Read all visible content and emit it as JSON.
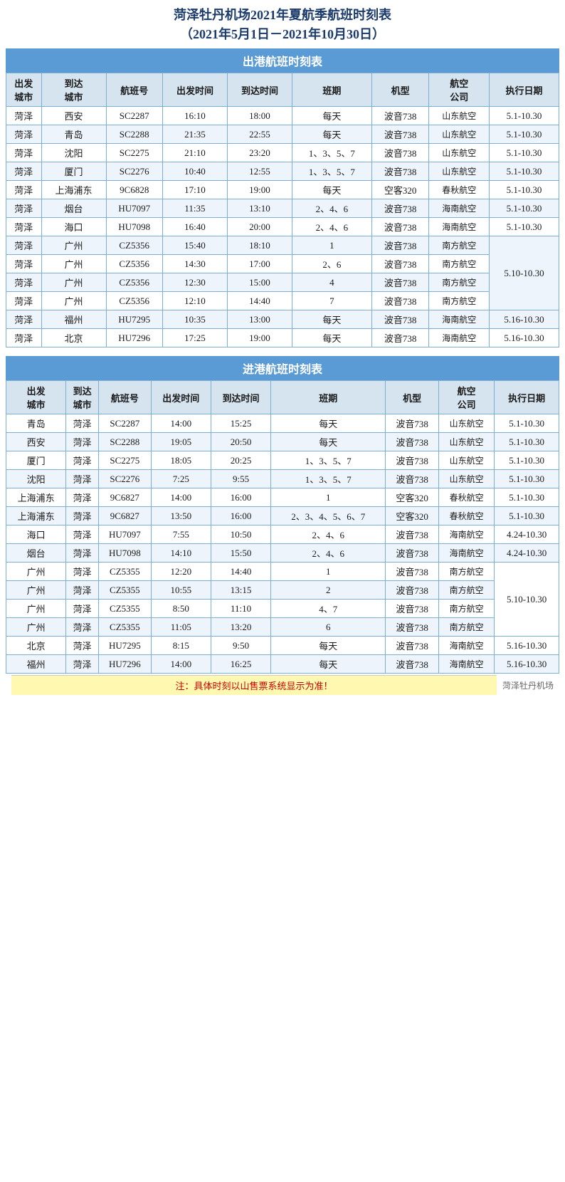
{
  "title": {
    "line1": "菏泽牡丹机场2021年夏航季航班时刻表",
    "line2": "（2021年5月1日－2021年10月30日）"
  },
  "departure_section": {
    "header": "出港航班时刻表",
    "columns": [
      "出发城市",
      "到达城市",
      "航班号",
      "出发时间",
      "到达时间",
      "班期",
      "机型",
      "航空公司",
      "执行日期"
    ],
    "rows": [
      [
        "菏泽",
        "西安",
        "SC2287",
        "16:10",
        "18:00",
        "每天",
        "波音738",
        "山东航空",
        "5.1-10.30"
      ],
      [
        "菏泽",
        "青岛",
        "SC2288",
        "21:35",
        "22:55",
        "每天",
        "波音738",
        "山东航空",
        "5.1-10.30"
      ],
      [
        "菏泽",
        "沈阳",
        "SC2275",
        "21:10",
        "23:20",
        "1、3、5、7",
        "波音738",
        "山东航空",
        "5.1-10.30"
      ],
      [
        "菏泽",
        "厦门",
        "SC2276",
        "10:40",
        "12:55",
        "1、3、5、7",
        "波音738",
        "山东航空",
        "5.1-10.30"
      ],
      [
        "菏泽",
        "上海浦东",
        "9C6828",
        "17:10",
        "19:00",
        "每天",
        "空客320",
        "春秋航空",
        "5.1-10.30"
      ],
      [
        "菏泽",
        "烟台",
        "HU7097",
        "11:35",
        "13:10",
        "2、4、6",
        "波音738",
        "海南航空",
        "5.1-10.30"
      ],
      [
        "菏泽",
        "海口",
        "HU7098",
        "16:40",
        "20:00",
        "2、4、6",
        "波音738",
        "海南航空",
        "5.1-10.30"
      ],
      [
        "菏泽",
        "广州",
        "CZ5356",
        "15:40",
        "18:10",
        "1",
        "波音738",
        "南方航空",
        ""
      ],
      [
        "菏泽",
        "广州",
        "CZ5356",
        "14:30",
        "17:00",
        "2、6",
        "波音738",
        "南方航空",
        ""
      ],
      [
        "菏泽",
        "广州",
        "CZ5356",
        "12:30",
        "15:00",
        "4",
        "波音738",
        "南方航空",
        "5.10-10.30"
      ],
      [
        "菏泽",
        "广州",
        "CZ5356",
        "12:10",
        "14:40",
        "7",
        "波音738",
        "南方航空",
        ""
      ],
      [
        "菏泽",
        "福州",
        "HU7295",
        "10:35",
        "13:00",
        "每天",
        "波音738",
        "海南航空",
        "5.16-10.30"
      ],
      [
        "菏泽",
        "北京",
        "HU7296",
        "17:25",
        "19:00",
        "每天",
        "波音738",
        "海南航空",
        "5.16-10.30"
      ]
    ]
  },
  "arrival_section": {
    "header": "进港航班时刻表",
    "columns": [
      "出发城市",
      "到达城市",
      "航班号",
      "出发时间",
      "到达时间",
      "班期",
      "机型",
      "航空公司",
      "执行日期"
    ],
    "rows": [
      [
        "青岛",
        "菏泽",
        "SC2287",
        "14:00",
        "15:25",
        "每天",
        "波音738",
        "山东航空",
        "5.1-10.30"
      ],
      [
        "西安",
        "菏泽",
        "SC2288",
        "19:05",
        "20:50",
        "每天",
        "波音738",
        "山东航空",
        "5.1-10.30"
      ],
      [
        "厦门",
        "菏泽",
        "SC2275",
        "18:05",
        "20:25",
        "1、3、5、7",
        "波音738",
        "山东航空",
        "5.1-10.30"
      ],
      [
        "沈阳",
        "菏泽",
        "SC2276",
        "7:25",
        "9:55",
        "1、3、5、7",
        "波音738",
        "山东航空",
        "5.1-10.30"
      ],
      [
        "上海浦东",
        "菏泽",
        "9C6827",
        "14:00",
        "16:00",
        "1",
        "空客320",
        "春秋航空",
        "5.1-10.30"
      ],
      [
        "上海浦东",
        "菏泽",
        "9C6827",
        "13:50",
        "16:00",
        "2、3、4、5、6、7",
        "空客320",
        "春秋航空",
        "5.1-10.30"
      ],
      [
        "海口",
        "菏泽",
        "HU7097",
        "7:55",
        "10:50",
        "2、4、6",
        "波音738",
        "海南航空",
        "4.24-10.30"
      ],
      [
        "烟台",
        "菏泽",
        "HU7098",
        "14:10",
        "15:50",
        "2、4、6",
        "波音738",
        "海南航空",
        "4.24-10.30"
      ],
      [
        "广州",
        "菏泽",
        "CZ5355",
        "12:20",
        "14:40",
        "1",
        "波音738",
        "南方航空",
        ""
      ],
      [
        "广州",
        "菏泽",
        "CZ5355",
        "10:55",
        "13:15",
        "2",
        "波音738",
        "南方航空",
        ""
      ],
      [
        "广州",
        "菏泽",
        "CZ5355",
        "8:50",
        "11:10",
        "4、7",
        "波音738",
        "南方航空",
        "5.10-10.30"
      ],
      [
        "广州",
        "菏泽",
        "CZ5355",
        "11:05",
        "13:20",
        "6",
        "波音738",
        "南方航空",
        ""
      ],
      [
        "北京",
        "菏泽",
        "HU7295",
        "8:15",
        "9:50",
        "每天",
        "波音738",
        "海南航空",
        "5.16-10.30"
      ],
      [
        "福州",
        "菏泽",
        "HU7296",
        "14:00",
        "16:25",
        "每天",
        "波音738",
        "海南航空",
        "5.16-10.30"
      ]
    ]
  },
  "note": "注：具体时刻以山售票系统显示为准！",
  "watermark": "菏泽牡丹机场"
}
